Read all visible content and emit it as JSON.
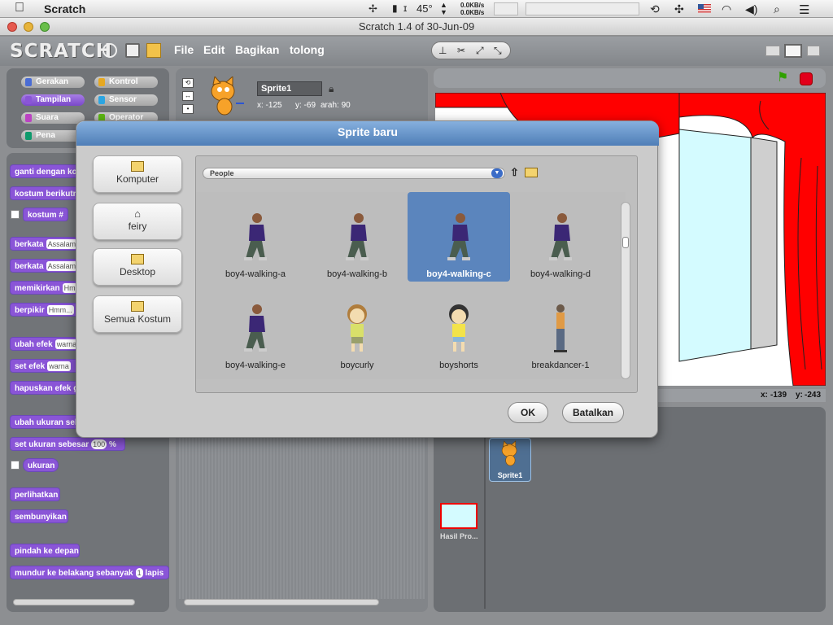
{
  "menubar": {
    "app_name": "Scratch",
    "temperature": "45°",
    "net_up": "0.0KB/s",
    "net_down": "0.0KB/s"
  },
  "window": {
    "title": "Scratch 1.4 of 30-Jun-09"
  },
  "toolbar": {
    "logo": "SCRATCH",
    "menus": [
      "File",
      "Edit",
      "Bagikan",
      "tolong"
    ]
  },
  "categories": {
    "motion": "Gerakan",
    "control": "Kontrol",
    "looks": "Tampilan",
    "sensing": "Sensor",
    "sound": "Suara",
    "operators": "Operator",
    "pen": "Pena"
  },
  "blocks": {
    "switch_costume": "ganti dengan ko",
    "next_costume": "kostum berikutn",
    "costume_num": "kostum #",
    "say_for": "berkata",
    "say_for_arg": "Assalam",
    "say": "berkata",
    "say_arg": "Assalam",
    "think_for": "memikirkan",
    "think_for_arg": "Hm",
    "think": "berpikir",
    "think_arg": "Hmm...",
    "change_effect": "ubah efek",
    "change_effect_arg": "warna",
    "set_effect": "set efek",
    "set_effect_arg": "warna",
    "clear_effects": "hapuskan efek g",
    "change_size": "ubah ukuran seb",
    "set_size": "set ukuran sebesar",
    "set_size_arg": "100",
    "set_size_unit": "%",
    "size": "ukuran",
    "show": "perlihatkan",
    "hide": "sembunyikan",
    "front": "pindah ke depan",
    "back": "mundur ke belakang sebanyak",
    "back_arg": "1",
    "back_unit": "lapis"
  },
  "sprite_info": {
    "name": "Sprite1",
    "x": "x: -125",
    "y": "y: -69",
    "direction": "arah: 90"
  },
  "stage": {
    "mouse_x_label": "x:",
    "mouse_x": "-139",
    "mouse_y_label": "y:",
    "mouse_y": "-243"
  },
  "sprite_list": {
    "sprite": "Sprite1",
    "stage": "Hasil Pro..."
  },
  "dialog": {
    "title": "Sprite baru",
    "sidebar": [
      {
        "label": "Komputer",
        "icon": "computer-icon"
      },
      {
        "label": "feiry",
        "icon": "home-icon"
      },
      {
        "label": "Desktop",
        "icon": "folder-icon"
      },
      {
        "label": "Semua Kostum",
        "icon": "costumes-folder-icon"
      }
    ],
    "path": "People",
    "items": [
      {
        "label": "boy4-walking-a",
        "selected": false
      },
      {
        "label": "boy4-walking-b",
        "selected": false
      },
      {
        "label": "boy4-walking-c",
        "selected": true
      },
      {
        "label": "boy4-walking-d",
        "selected": false
      },
      {
        "label": "boy4-walking-e",
        "selected": false
      },
      {
        "label": "boycurly",
        "selected": false
      },
      {
        "label": "boyshorts",
        "selected": false
      },
      {
        "label": "breakdancer-1",
        "selected": false
      }
    ],
    "ok_label": "OK",
    "cancel_label": "Batalkan"
  },
  "colors": {
    "looks_block": "#8a55d7",
    "dialog_title": "#5d8cc4",
    "selection": "#5b85bd",
    "curtain": "#ff0000"
  }
}
